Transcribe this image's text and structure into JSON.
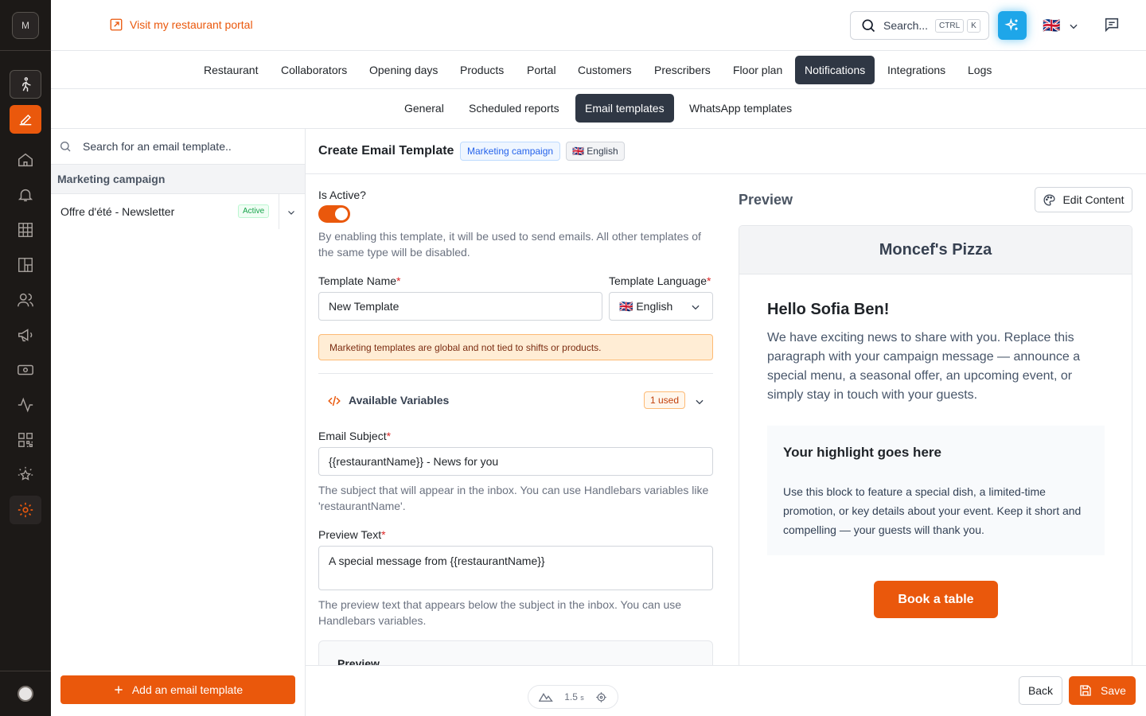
{
  "sidebar": {
    "logo_letter": "M",
    "items": [
      {
        "icon": "walking-person-icon"
      },
      {
        "icon": "pencil-edit-icon",
        "active": true
      },
      {
        "icon": "home-icon"
      },
      {
        "icon": "bell-icon"
      },
      {
        "icon": "grid-icon"
      },
      {
        "icon": "floor-plan-icon"
      },
      {
        "icon": "users-icon"
      },
      {
        "icon": "megaphone-icon"
      },
      {
        "icon": "money-icon"
      },
      {
        "icon": "activity-icon"
      },
      {
        "icon": "qr-code-icon"
      },
      {
        "icon": "star-sparkle-icon"
      },
      {
        "icon": "gear-icon",
        "selected": true
      }
    ]
  },
  "topbar": {
    "visit_link": "Visit my restaurant portal",
    "search_label": "Search...",
    "kbd_ctrl": "CTRL",
    "kbd_k": "K",
    "language_flag": "🇬🇧"
  },
  "main_tabs": [
    "Restaurant",
    "Collaborators",
    "Opening days",
    "Products",
    "Portal",
    "Customers",
    "Prescribers",
    "Floor plan",
    "Notifications",
    "Integrations",
    "Logs"
  ],
  "main_tabs_selected": "Notifications",
  "sub_tabs": [
    "General",
    "Scheduled reports",
    "Email templates",
    "WhatsApp templates"
  ],
  "sub_tabs_selected": "Email templates",
  "left_panel": {
    "search_placeholder": "Search for an email template..",
    "group_label": "Marketing campaign",
    "items": [
      {
        "name": "Offre d'été - Newsletter",
        "status": "Active"
      }
    ],
    "add_button": "Add an email template"
  },
  "editor": {
    "title": "Create Email Template",
    "type_chip": "Marketing campaign",
    "lang_chip": "🇬🇧 English",
    "is_active_label": "Is Active?",
    "is_active": true,
    "is_active_help": "By enabling this template, it will be used to send emails. All other templates of the same type will be disabled.",
    "name_label": "Template Name",
    "name_value": "New Template",
    "language_label": "Template Language",
    "language_value": "🇬🇧 English",
    "notice": "Marketing templates are global and not tied to shifts or products.",
    "variables_label": "Available Variables",
    "variables_used": "1 used",
    "subject_label": "Email Subject",
    "subject_value": "{{restaurantName}} - News for you",
    "subject_help": "The subject that will appear in the inbox. You can use Handlebars variables like 'restaurantName'.",
    "preview_text_label": "Preview Text",
    "preview_text_value": "A special message from {{restaurantName}}",
    "preview_text_help": "The preview text that appears below the subject in the inbox. You can use Handlebars variables.",
    "preview_card_label": "Preview"
  },
  "preview": {
    "title": "Preview",
    "edit_button": "Edit Content",
    "email": {
      "header": "Moncef's Pizza",
      "greeting": "Hello Sofia Ben!",
      "body": "We have exciting news to share with you. Replace this paragraph with your campaign message — announce a special menu, a seasonal offer, an upcoming event, or simply stay in touch with your guests.",
      "highlight_title": "Your highlight goes here",
      "highlight_body": "Use this block to feature a special dish, a limited-time promotion, or key details about your event. Keep it short and compelling — your guests will thank you.",
      "cta": "Book a table"
    }
  },
  "footer": {
    "perf_value": "1.5",
    "perf_unit": "s",
    "back": "Back",
    "save": "Save"
  },
  "colors": {
    "accent": "#ea580c",
    "sidebar": "#1c1917",
    "selected_tab": "#2f3744",
    "ai_button": "#1ea6e9"
  }
}
